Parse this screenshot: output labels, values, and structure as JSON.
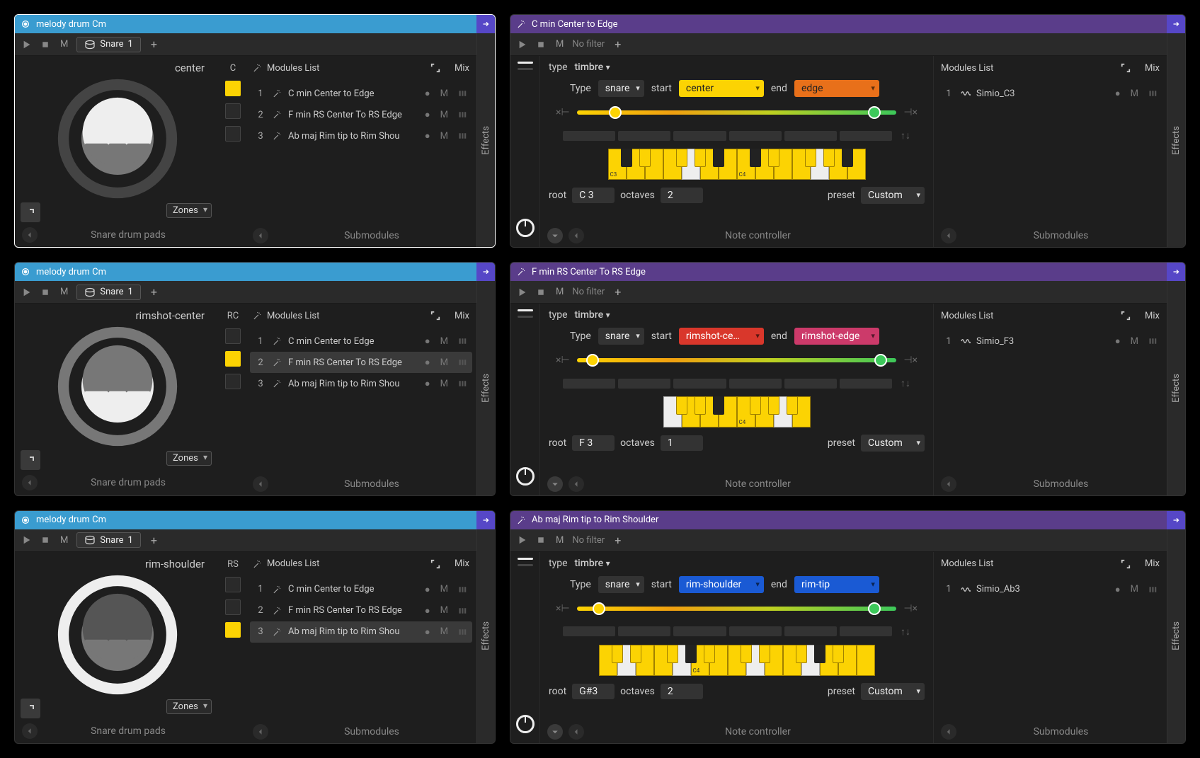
{
  "left": [
    {
      "title": "melody drum Cm",
      "m": "M",
      "snare": {
        "label": "Snare",
        "num": "1"
      },
      "plus": "+",
      "padZone": "center",
      "zoneLabel": "C",
      "zones": "Zones",
      "padsFooter": "Snare drum pads",
      "modHeader": "Modules List",
      "mix": "Mix",
      "squares": [
        "yellow",
        "dark",
        "dark"
      ],
      "mods": [
        {
          "n": "1",
          "name": "C min Center to Edge",
          "sel": false
        },
        {
          "n": "2",
          "name": "F min RS Center To RS Edge",
          "sel": false
        },
        {
          "n": "3",
          "name": "Ab maj Rim tip to Rim Shou",
          "sel": false
        }
      ],
      "subFooter": "Submodules",
      "effects": "Effects",
      "drumStroke": "#444",
      "drumMid": "#eee",
      "drumDark": "#777"
    },
    {
      "title": "melody drum Cm",
      "m": "M",
      "snare": {
        "label": "Snare",
        "num": "1"
      },
      "plus": "+",
      "padZone": "rimshot-center",
      "zoneLabel": "RC",
      "zones": "Zones",
      "padsFooter": "Snare drum pads",
      "modHeader": "Modules List",
      "mix": "Mix",
      "squares": [
        "dark",
        "yellow",
        "dark"
      ],
      "mods": [
        {
          "n": "1",
          "name": "C min Center to Edge",
          "sel": false
        },
        {
          "n": "2",
          "name": "F min RS Center To RS Edge",
          "sel": true
        },
        {
          "n": "3",
          "name": "Ab maj Rim tip to Rim Shou",
          "sel": false
        }
      ],
      "subFooter": "Submodules",
      "effects": "Effects",
      "drumStroke": "#777",
      "drumMid": "#777",
      "drumDark": "#eee"
    },
    {
      "title": "melody drum Cm",
      "m": "M",
      "snare": {
        "label": "Snare",
        "num": "1"
      },
      "plus": "+",
      "padZone": "rim-shoulder",
      "zoneLabel": "RS",
      "zones": "Zones",
      "padsFooter": "Snare drum pads",
      "modHeader": "Modules List",
      "mix": "Mix",
      "squares": [
        "dark",
        "dark",
        "yellow"
      ],
      "mods": [
        {
          "n": "1",
          "name": "C min Center to Edge",
          "sel": false
        },
        {
          "n": "2",
          "name": "F min RS Center To RS Edge",
          "sel": false
        },
        {
          "n": "3",
          "name": "Ab maj Rim tip to Rim Shou",
          "sel": true
        }
      ],
      "subFooter": "Submodules",
      "effects": "Effects",
      "drumStroke": "#eee",
      "drumMid": "#555",
      "drumDark": "#777"
    }
  ],
  "right": [
    {
      "title": "C min Center to Edge",
      "m": "M",
      "nofilter": "No filter",
      "plus": "+",
      "typeLabel": "type",
      "timbre": "timbre",
      "TypeLabel": "Type",
      "snare": "snare",
      "startLabel": "start",
      "endLabel": "end",
      "startVal": "center",
      "endVal": "edge",
      "startClass": "yellow",
      "endClass": "orange",
      "thumbLeft": 12,
      "thumbRight": 93,
      "rootLabel": "root",
      "rootVal": "C  3",
      "octLabel": "octaves",
      "octVal": "2",
      "presetLabel": "preset",
      "presetVal": "Custom",
      "ncFooter": "Note controller",
      "modHeader": "Modules List",
      "mix": "Mix",
      "mods": [
        {
          "n": "1",
          "name": "Simio_C3"
        }
      ],
      "subFooter": "Submodules",
      "effects": "Effects",
      "piano": {
        "keys": 14,
        "black": [
          0,
          1,
          3,
          4,
          5,
          7,
          8,
          10,
          11,
          12
        ],
        "by": [
          1,
          3,
          4,
          8,
          10,
          11
        ],
        "wy": [
          0,
          1,
          2,
          3,
          5,
          6,
          7,
          8,
          9,
          10,
          12,
          13
        ],
        "c": [
          {
            "i": 0,
            "t": "C3"
          },
          {
            "i": 7,
            "t": "C4"
          }
        ]
      }
    },
    {
      "title": "F min RS Center To RS Edge",
      "m": "M",
      "nofilter": "No filter",
      "plus": "+",
      "typeLabel": "type",
      "timbre": "timbre",
      "TypeLabel": "Type",
      "snare": "snare",
      "startLabel": "start",
      "endLabel": "end",
      "startVal": "rimshot-ce…",
      "endVal": "rimshot-edge",
      "startClass": "red",
      "endClass": "pink",
      "thumbLeft": 5,
      "thumbRight": 95,
      "rootLabel": "root",
      "rootVal": "F  3",
      "octLabel": "octaves",
      "octVal": "1",
      "presetLabel": "preset",
      "presetVal": "Custom",
      "ncFooter": "Note controller",
      "modHeader": "Modules List",
      "mix": "Mix",
      "mods": [
        {
          "n": "1",
          "name": "Simio_F3"
        }
      ],
      "subFooter": "Submodules",
      "effects": "Effects",
      "piano": {
        "keys": 8,
        "black": [
          0,
          1,
          2,
          4,
          5,
          6
        ],
        "by": [
          0,
          1,
          4,
          5,
          6
        ],
        "wy": [
          1,
          2,
          3,
          4,
          5,
          7
        ],
        "c": [
          {
            "i": 4,
            "t": "C4"
          }
        ]
      }
    },
    {
      "title": "Ab maj Rim tip to Rim Shoulder",
      "m": "M",
      "nofilter": "No filter",
      "plus": "+",
      "typeLabel": "type",
      "timbre": "timbre",
      "TypeLabel": "Type",
      "snare": "snare",
      "startLabel": "start",
      "endLabel": "end",
      "startVal": "rim-shoulder",
      "endVal": "rim-tip",
      "startClass": "blue1",
      "endClass": "blue2",
      "thumbLeft": 7,
      "thumbRight": 93,
      "rootLabel": "root",
      "rootVal": "G#3",
      "octLabel": "octaves",
      "octVal": "2",
      "presetLabel": "preset",
      "presetVal": "Custom",
      "ncFooter": "Note controller",
      "modHeader": "Modules List",
      "mix": "Mix",
      "mods": [
        {
          "n": "1",
          "name": "Simio_Ab3"
        }
      ],
      "subFooter": "Submodules",
      "effects": "Effects",
      "piano": {
        "keys": 15,
        "black": [
          0,
          1,
          3,
          4,
          5,
          7,
          8,
          10,
          11,
          12
        ],
        "by": [
          0,
          1,
          3,
          5,
          7,
          8,
          10,
          12
        ],
        "wy": [
          0,
          2,
          3,
          5,
          6,
          7,
          9,
          10,
          12,
          13,
          14
        ],
        "c": [
          {
            "i": 5,
            "t": "C4"
          }
        ]
      }
    }
  ]
}
